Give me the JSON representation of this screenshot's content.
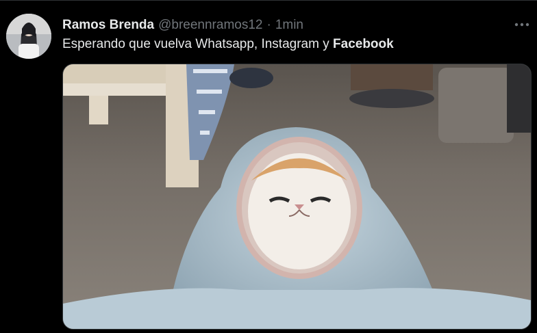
{
  "tweet": {
    "author": {
      "display_name": "Ramos Brenda",
      "handle": "@breennramos12",
      "avatar_icon": "profile-avatar"
    },
    "separator": "·",
    "timestamp": "1min",
    "text_parts": [
      "Esperando que vuelva Whatsapp, Instagram y ",
      "Facebook"
    ],
    "more_icon": "more-options-icon",
    "media": {
      "type": "photo",
      "content": "cat wrapped in a light blue blanket sitting on carpet"
    }
  },
  "colors": {
    "background": "#000000",
    "text": "#e7e9ea",
    "secondary_text": "#71767b",
    "border": "#2f3336"
  }
}
